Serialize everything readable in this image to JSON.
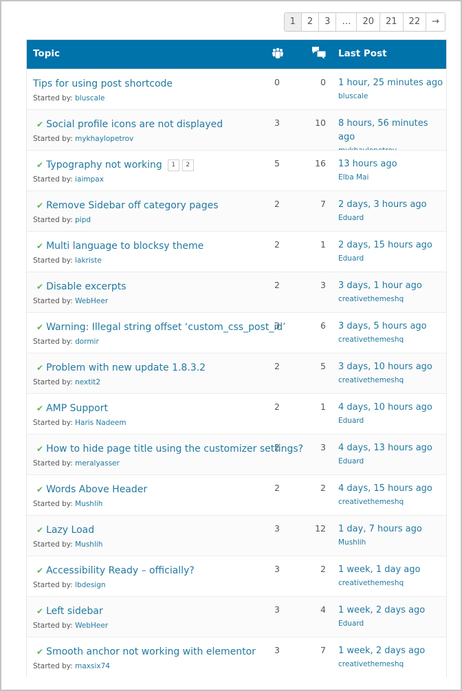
{
  "pagination": {
    "pages": [
      "1",
      "2",
      "3",
      "…",
      "20",
      "21",
      "22",
      "→"
    ],
    "current": "1"
  },
  "table": {
    "headers": {
      "topic": "Topic",
      "voices_icon": "voices-icon",
      "replies_icon": "replies-icon",
      "last_post": "Last Post"
    },
    "started_by_label": "Started by:",
    "resolved_icon": "checkmark-icon",
    "colors": {
      "header_bg": "#0073aa",
      "link": "#23799f",
      "check": "#5ab55a"
    },
    "rows": [
      {
        "title": "Tips for using post shortcode",
        "resolved": false,
        "author": "bluscale",
        "voices": "0",
        "replies": "0",
        "freshness": "1 hour, 25 minutes ago",
        "last_author": "bluscale"
      },
      {
        "title": "Social profile icons are not displayed",
        "resolved": true,
        "author": "mykhaylopetrov",
        "voices": "3",
        "replies": "10",
        "freshness": "8 hours, 56 minutes ago",
        "last_author": "mykhaylopetrov"
      },
      {
        "title": "Typography not working",
        "resolved": true,
        "author": "iaimpax",
        "voices": "5",
        "replies": "16",
        "freshness": "13 hours ago",
        "last_author": "Elba Mai",
        "topic_pages": [
          "1",
          "2"
        ]
      },
      {
        "title": "Remove Sidebar off category pages",
        "resolved": true,
        "author": "pipd",
        "voices": "2",
        "replies": "7",
        "freshness": "2 days, 3 hours ago",
        "last_author": "Eduard"
      },
      {
        "title": "Multi language to blocksy theme",
        "resolved": true,
        "author": "lakriste",
        "voices": "2",
        "replies": "1",
        "freshness": "2 days, 15 hours ago",
        "last_author": "Eduard"
      },
      {
        "title": "Disable excerpts",
        "resolved": true,
        "author": "WebHeer",
        "voices": "2",
        "replies": "3",
        "freshness": "3 days, 1 hour ago",
        "last_author": "creativethemeshq"
      },
      {
        "title": "Warning: Illegal string offset ‘custom_css_post_id’",
        "resolved": true,
        "author": "dormir",
        "voices": "3",
        "replies": "6",
        "freshness": "3 days, 5 hours ago",
        "last_author": "creativethemeshq"
      },
      {
        "title": "Problem with new update 1.8.3.2",
        "resolved": true,
        "author": "nextit2",
        "voices": "2",
        "replies": "5",
        "freshness": "3 days, 10 hours ago",
        "last_author": "creativethemeshq"
      },
      {
        "title": "AMP Support",
        "resolved": true,
        "author": "Haris Nadeem",
        "voices": "2",
        "replies": "1",
        "freshness": "4 days, 10 hours ago",
        "last_author": "Eduard"
      },
      {
        "title": "How to hide page title using the customizer settings?",
        "resolved": true,
        "author": "meralyasser",
        "voices": "2",
        "replies": "3",
        "freshness": "4 days, 13 hours ago",
        "last_author": "Eduard"
      },
      {
        "title": "Words Above Header",
        "resolved": true,
        "author": "Mushlih",
        "voices": "2",
        "replies": "2",
        "freshness": "4 days, 15 hours ago",
        "last_author": "creativethemeshq"
      },
      {
        "title": "Lazy Load",
        "resolved": true,
        "author": "Mushlih",
        "voices": "3",
        "replies": "12",
        "freshness": "1 day, 7 hours ago",
        "last_author": "Mushlih"
      },
      {
        "title": "Accessibility Ready – officially?",
        "resolved": true,
        "author": "lbdesign",
        "voices": "3",
        "replies": "2",
        "freshness": "1 week, 1 day ago",
        "last_author": "creativethemeshq"
      },
      {
        "title": "Left sidebar",
        "resolved": true,
        "author": "WebHeer",
        "voices": "3",
        "replies": "4",
        "freshness": "1 week, 2 days ago",
        "last_author": "Eduard"
      },
      {
        "title": "Smooth anchor not working with elementor",
        "resolved": true,
        "author": "maxsix74",
        "voices": "3",
        "replies": "7",
        "freshness": "1 week, 2 days ago",
        "last_author": "creativethemeshq"
      }
    ]
  }
}
